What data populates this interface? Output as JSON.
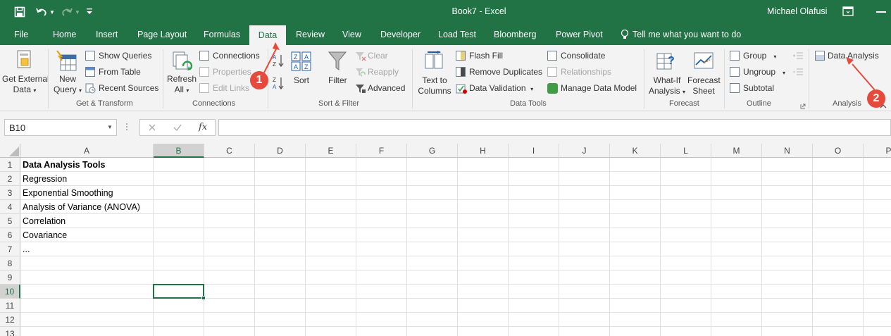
{
  "window": {
    "title": "Book7  -  Excel",
    "user": "Michael Olafusi"
  },
  "qat": {
    "save_icon": "save-icon",
    "undo_icon": "undo-icon",
    "redo_icon": "redo-icon",
    "customize_icon": "chevron-down-icon"
  },
  "tabs": [
    {
      "label": "File"
    },
    {
      "label": "Home"
    },
    {
      "label": "Insert"
    },
    {
      "label": "Page Layout"
    },
    {
      "label": "Formulas"
    },
    {
      "label": "Data"
    },
    {
      "label": "Review"
    },
    {
      "label": "View"
    },
    {
      "label": "Developer"
    },
    {
      "label": "Load Test"
    },
    {
      "label": "Bloomberg"
    },
    {
      "label": "Power Pivot"
    }
  ],
  "tell_me": "Tell me what you want to do",
  "ribbon": {
    "get_external": {
      "line1": "Get External",
      "line2": "Data"
    },
    "new_query": {
      "line1": "New",
      "line2": "Query"
    },
    "show_queries": "Show Queries",
    "from_table": "From Table",
    "recent_sources": "Recent Sources",
    "group_get_transform": "Get & Transform",
    "refresh": {
      "line1": "Refresh",
      "line2": "All"
    },
    "connections": "Connections",
    "properties": "Properties",
    "edit_links": "Edit Links",
    "group_connections": "Connections",
    "sort": "Sort",
    "filter": "Filter",
    "clear": "Clear",
    "reapply": "Reapply",
    "advanced": "Advanced",
    "group_sort_filter": "Sort & Filter",
    "text_to_columns": {
      "line1": "Text to",
      "line2": "Columns"
    },
    "flash_fill": "Flash Fill",
    "remove_duplicates": "Remove Duplicates",
    "data_validation": "Data Validation",
    "consolidate": "Consolidate",
    "relationships": "Relationships",
    "manage_data_model": "Manage Data Model",
    "group_data_tools": "Data Tools",
    "what_if": {
      "line1": "What-If",
      "line2": "Analysis"
    },
    "forecast_sheet": {
      "line1": "Forecast",
      "line2": "Sheet"
    },
    "group_forecast": "Forecast",
    "group_btn": "Group",
    "ungroup_btn": "Ungroup",
    "subtotal": "Subtotal",
    "group_outline": "Outline",
    "data_analysis": "Data Analysis",
    "group_analysis": "Analysis"
  },
  "formula_bar": {
    "name_box": "B10",
    "fx": "fx",
    "formula": ""
  },
  "sheet": {
    "columns": [
      "A",
      "B",
      "C",
      "D",
      "E",
      "F",
      "G",
      "H",
      "I",
      "J",
      "K",
      "L",
      "M",
      "N",
      "O",
      "P"
    ],
    "rows": [
      "1",
      "2",
      "3",
      "4",
      "5",
      "6",
      "7",
      "8",
      "9",
      "10",
      "11",
      "12",
      "13"
    ],
    "cells": {
      "A1": "Data Analysis Tools",
      "A2": "Regression",
      "A3": "Exponential Smoothing",
      "A4": "Analysis of Variance (ANOVA)",
      "A5": "Correlation",
      "A6": "Covariance",
      "A7": "..."
    },
    "active_cell": "B10"
  },
  "annotations": {
    "badge1": "1",
    "badge2": "2"
  },
  "colors": {
    "excel_green": "#217346",
    "annotation_red": "#e64a3c"
  }
}
